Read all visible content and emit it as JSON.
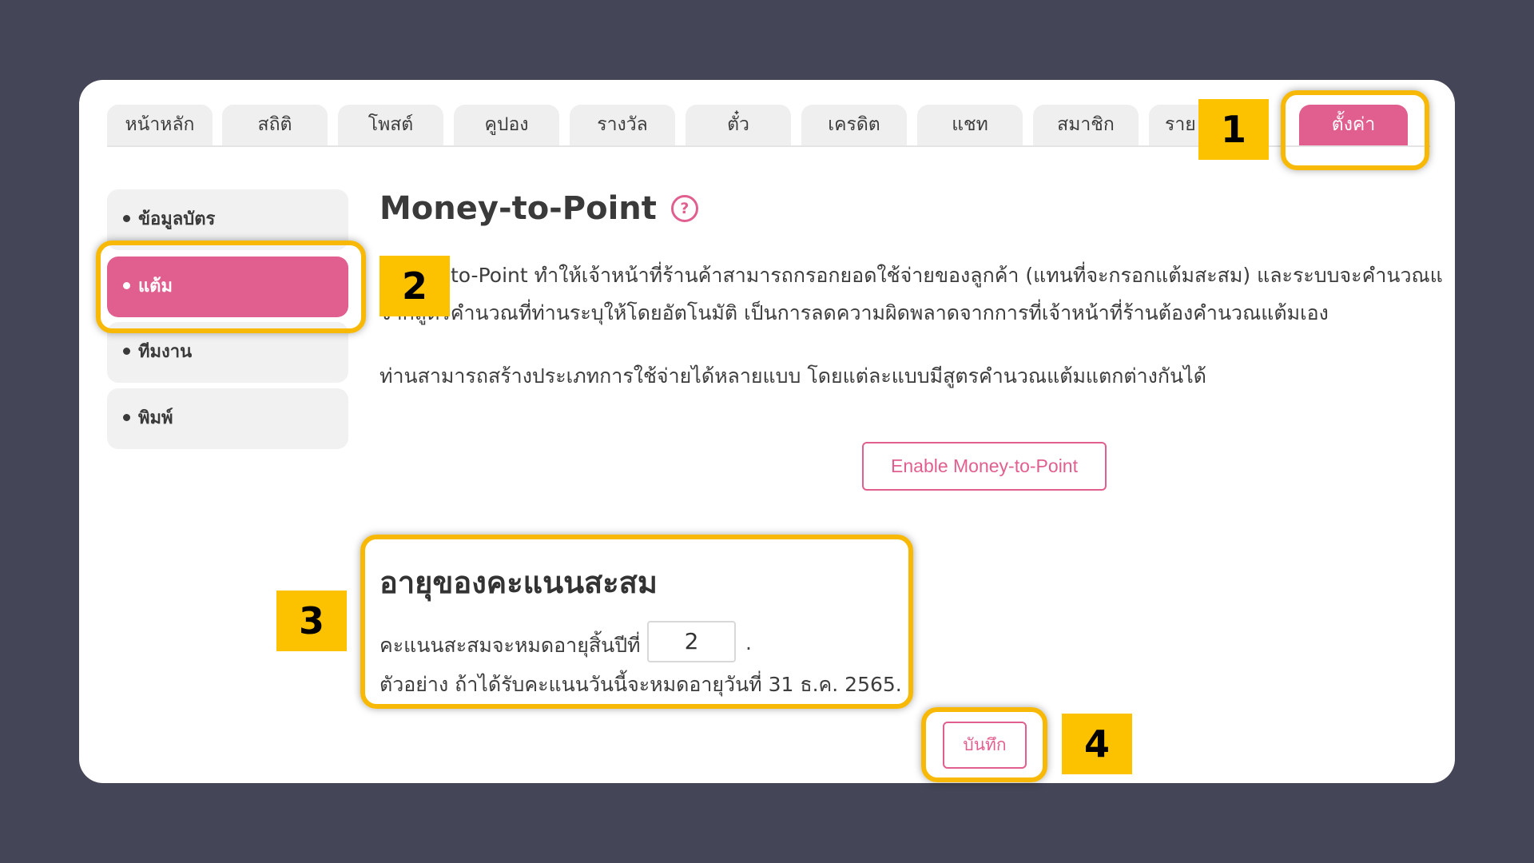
{
  "tabs": [
    {
      "label": "หน้าหลัก",
      "active": false
    },
    {
      "label": "สถิติ",
      "active": false
    },
    {
      "label": "โพสต์",
      "active": false
    },
    {
      "label": "คูปอง",
      "active": false
    },
    {
      "label": "รางวัล",
      "active": false
    },
    {
      "label": "ตั๋ว",
      "active": false
    },
    {
      "label": "เครดิต",
      "active": false
    },
    {
      "label": "แชท",
      "active": false
    },
    {
      "label": "สมาชิก",
      "active": false
    },
    {
      "label": "ราย",
      "active": false
    },
    {
      "label": "ตั้งค่า",
      "active": true
    }
  ],
  "sidebar": {
    "items": [
      {
        "label": "ข้อมูลบัตร",
        "active": false
      },
      {
        "label": "แต้ม",
        "active": true
      },
      {
        "label": "ทีมงาน",
        "active": false
      },
      {
        "label": "พิมพ์",
        "active": false
      }
    ]
  },
  "content": {
    "title": "Money-to-Point",
    "help_icon": "?",
    "para1_line1": "to-Point ทำให้เจ้าหน้าที่ร้านค้าสามารถกรอกยอดใช้จ่ายของลูกค้า (แทนที่จะกรอกแต้มสะสม) และระบบจะคำนวณแต้มให้",
    "para1_line2": "จากสูตรคำนวณที่ท่านระบุให้โดยอัตโนมัติ เป็นการลดความผิดพลาดจากการที่เจ้าหน้าที่ร้านต้องคำนวณแต้มเอง",
    "para2": "ท่านสามารถสร้างประเภทการใช้จ่ายได้หลายแบบ โดยแต่ละแบบมีสูตรคำนวณแต้มแตกต่างกันได้",
    "enable_button": "Enable Money-to-Point"
  },
  "expiry": {
    "title": "อายุของคะแนนสะสม",
    "label": "คะแนนสะสมจะหมดอายุสิ้นปีที่",
    "value": "2",
    "suffix": ".",
    "example": "ตัวอย่าง ถ้าได้รับคะแนนวันนี้จะหมดอายุวันที่ 31 ธ.ค. 2565."
  },
  "save_button": "บันทึก",
  "badges": [
    "1",
    "2",
    "3",
    "4"
  ],
  "colors": {
    "accent": "#e15f8f",
    "highlight": "#f7b906",
    "badge": "#fcc200",
    "background": "#444556"
  }
}
